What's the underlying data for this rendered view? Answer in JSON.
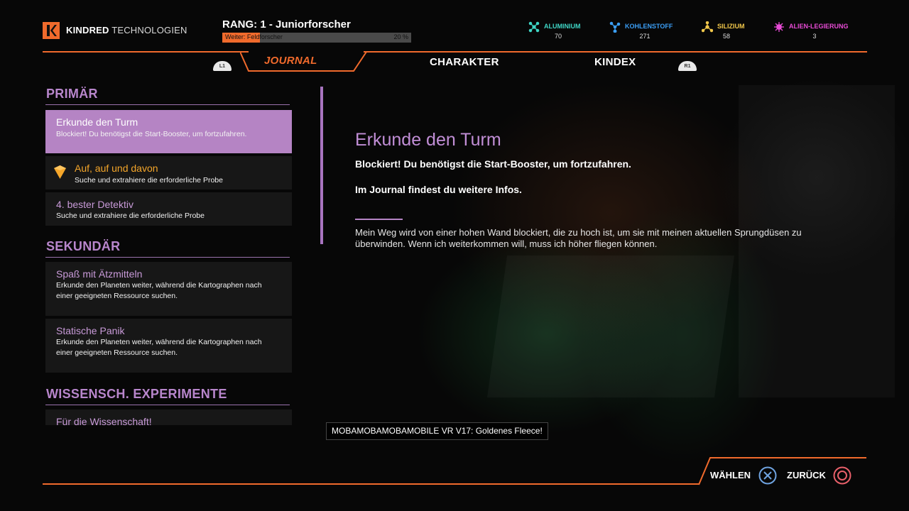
{
  "header": {
    "brand_bold": "KINDRED",
    "brand_light": "TECHNOLOGIEN",
    "rank_label": "RANG: 1 - Juniorforscher",
    "rank_next": "Weiter: Feldforscher",
    "rank_progress_text": "20 %",
    "rank_progress": 0.2
  },
  "resources": [
    {
      "name": "ALUMINIUM",
      "value": "70",
      "color": "#3fd6c6",
      "icon": "aluminium-molecule-icon"
    },
    {
      "name": "KOHLENSTOFF",
      "value": "271",
      "color": "#3b9ef5",
      "icon": "kohlenstoff-molecule-icon"
    },
    {
      "name": "SILIZIUM",
      "value": "58",
      "color": "#f2c84b",
      "icon": "silizium-molecule-icon"
    },
    {
      "name": "ALIEN-LEGIERUNG",
      "value": "3",
      "color": "#e84bd6",
      "icon": "alien-legierung-molecule-icon"
    }
  ],
  "tabs": {
    "journal": "JOURNAL",
    "charakter": "CHARAKTER",
    "kindex": "KINDEX",
    "left_shoulder": "L1",
    "right_shoulder": "R1"
  },
  "sections": {
    "primary": "PRIMÄR",
    "secondary": "SEKUNDÄR",
    "science": "WISSENSCH. EXPERIMENTE"
  },
  "primary_quests": [
    {
      "title": "Erkunde den Turm",
      "desc": "Blockiert! Du benötigst die Start-Booster, um fortzufahren."
    },
    {
      "title": "Auf, auf und davon",
      "desc": "Suche und extrahiere die erforderliche Probe"
    },
    {
      "title": "4. bester Detektiv",
      "desc": "Suche und extrahiere die erforderliche Probe"
    }
  ],
  "secondary_quests": [
    {
      "title": "Spaß mit Ätzmitteln",
      "desc": "Erkunde den Planeten weiter, während die Kartographen nach einer geeigneten Ressource suchen."
    },
    {
      "title": "Statische Panik",
      "desc": "Erkunde den Planeten weiter, während die Kartographen nach einer geeigneten Ressource suchen."
    }
  ],
  "science_quests": [
    {
      "title": "Für die Wissenschaft!"
    }
  ],
  "detail": {
    "title": "Erkunde den Turm",
    "subtitle": "Blockiert! Du benötigst die Start-Booster, um fortzufahren.",
    "info": "Im Journal findest du weitere Infos.",
    "body": "Mein Weg wird von einer hohen Wand blockiert, die zu hoch ist, um sie mit meinen aktuellen Sprungdüsen zu überwinden. Wenn ich weiterkommen will, muss ich höher fliegen können."
  },
  "toast": "MOBAMOBAMOBAMOBILE VR V17: Goldenes Fleece!",
  "footer": {
    "select_label": "WÄHLEN",
    "back_label": "ZURÜCK"
  },
  "colors": {
    "accent": "#f06a2c",
    "quest_purple": "#b584c4",
    "quest_gold": "#f5a62a"
  }
}
